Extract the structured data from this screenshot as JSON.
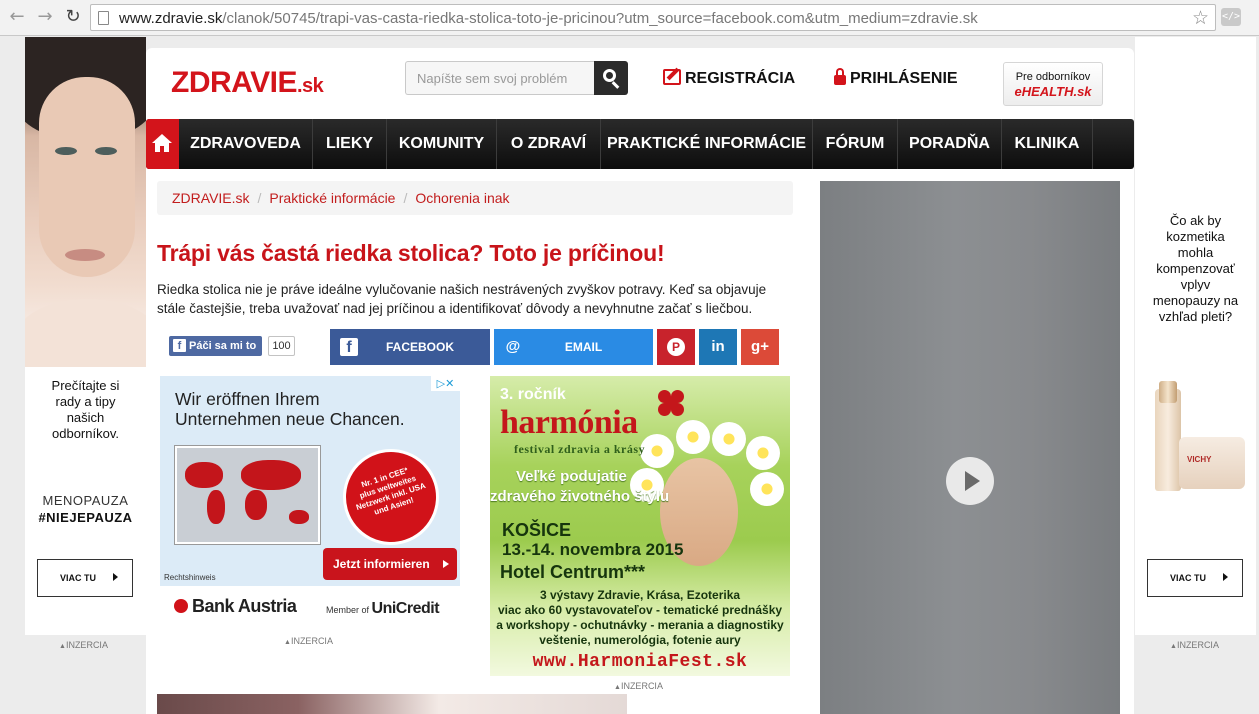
{
  "browser": {
    "url_host": "www.zdravie.sk",
    "url_path": "/clanok/50745/trapi-vas-casta-riedka-stolica-toto-je-pricinou?utm_source=facebook.com&utm_medium=zdravie.sk"
  },
  "left_ad": {
    "text": "Prečítajte si rady a tipy našich odborníkov.",
    "tag_line1": "MENOPAUZA",
    "tag_line2": "#NIEJEPAUZA",
    "button_label": "VIAC TU",
    "inzercia": "INZERCIA"
  },
  "right_ad": {
    "text": "Čo ak by kozmetika mohla kompenzovať vplyv menopauzy na vzhľad pleti?",
    "product_brand": "VICHY",
    "button_label": "VIAC TU",
    "inzercia": "INZERCIA"
  },
  "header": {
    "logo_main": "ZDRAVIE",
    "logo_suffix": ".sk",
    "search_placeholder": "Napíšte sem svoj problém",
    "register_label": "REGISTRÁCIA",
    "login_label": "PRIHLÁSENIE",
    "pro_line1": "Pre odborníkov",
    "pro_line2": "eHEALTH.sk"
  },
  "nav": {
    "items": [
      "ZDRAVOVEDA",
      "LIEKY",
      "KOMUNITY",
      "O ZDRAVÍ",
      "PRAKTICKÉ INFORMÁCIE",
      "FÓRUM",
      "PORADŇA",
      "KLINIKA"
    ]
  },
  "breadcrumb": [
    "ZDRAVIE.sk",
    "Praktické informácie",
    "Ochorenia inak"
  ],
  "article": {
    "title": "Trápi vás častá riedka stolica? Toto je príčinou!",
    "perex": "Riedka stolica nie je práve ideálne vylučovanie našich nestrávených zvyškov potravy. Keď sa objavuje stále častejšie, treba uvažovať nad jej príčinou a identifikovať dôvody a nevyhnutne začať s liečbou."
  },
  "social": {
    "fb_like_label": "Páči sa mi to",
    "fb_like_count": "100",
    "facebook_label": "FACEBOOK",
    "email_label": "EMAIL"
  },
  "ad_bank": {
    "headline_line1": "Wir eröffnen Ihrem",
    "headline_line2": "Unternehmen neue Chancen.",
    "badge_line1": "Nr. 1 in CEE*",
    "badge_line2": "plus weltweites",
    "badge_line3": "Netzwerk inkl. USA",
    "badge_line4": "und Asien!",
    "cta": "Jetzt informieren",
    "legal": "Rechtshinweis",
    "brand": "Bank Austria",
    "member": "Member of",
    "parent": "UniCredit",
    "inzercia": "INZERCIA"
  },
  "ad_harmonia": {
    "edition": "3. ročník",
    "name": "harmónia",
    "subtitle": "festival zdravia a krásy",
    "tagline1": "Veľké podujatie",
    "tagline2": "zdravého životného štýlu",
    "city": "KOŠICE",
    "dates": "13.-14. novembra 2015",
    "venue": "Hotel Centrum***",
    "line1": "3 výstavy Zdravie, Krása, Ezoterika",
    "line2": "viac ako 60 vystavovateľov - tematické prednášky",
    "line3": "a workshopy - ochutnávky - merania a diagnostiky",
    "line4": "veštenie, numerológia, fotenie aury",
    "website": "www.HarmoniaFest.sk",
    "inzercia": "INZERCIA"
  }
}
